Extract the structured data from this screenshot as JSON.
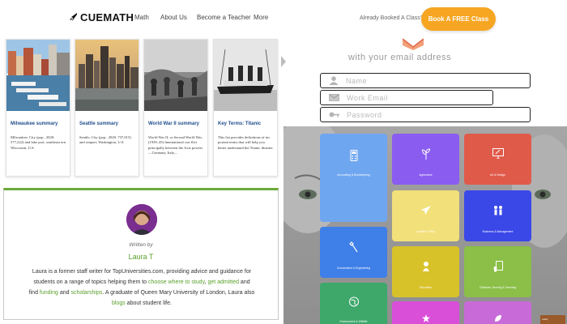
{
  "header": {
    "logo_text": "CUEMATH",
    "nav": [
      "Math",
      "About Us",
      "Become a Teacher",
      "More"
    ],
    "booked_text": "Already Booked A Class?",
    "cta_label": "Book A FREE Class",
    "cta_color": "#f6a623"
  },
  "cards": [
    {
      "title": "Milwaukee summary",
      "text": "Milwaukee, City (pop., 2020: 577,222) and lake port, southeast ern Wisconsin, U.S."
    },
    {
      "title": "Seattle summary",
      "text": "Seattle, City (pop., 2020: 737,015) and seaport, Washington, U.S."
    },
    {
      "title": "World War II summary",
      "text": "World War II, or Second World War, (1939–45) International con flict principally between the Axis powers—Germany, Italy,..."
    },
    {
      "title": "Key Terms: Titanic",
      "text": "This list provides definitions of im portant terms that will help you better understand the Titanic disaster."
    }
  ],
  "author": {
    "written_by": "Written by",
    "name": "Laura T",
    "bio_1": "Laura is a former staff writer for TopUniversities.com, providing advice and guidance for",
    "bio_2": "students on a range of topics helping them to ",
    "link_choose": "choose where to study",
    "sep_1": ", ",
    "link_admitted": "get admitted",
    "sep_2": " and",
    "bio_3": "find ",
    "link_funding": "funding",
    "sep_3": " and ",
    "link_scholarships": "scholarships",
    "bio_4": ". A graduate of Queen Mary University of London, Laura also",
    "link_blogs": "blogs",
    "bio_5": " about student life.",
    "accent": "#5aa02c"
  },
  "signup": {
    "heading": "with your email address",
    "name_placeholder": "Name",
    "email_placeholder": "Work Email",
    "password_placeholder": "Password"
  },
  "categories": [
    {
      "label": "Accounting & Bookkeeping",
      "color": "#6fa6f0",
      "icon": "calculator-icon"
    },
    {
      "label": "Agriculture",
      "color": "#8a5cf0",
      "icon": "plant-icon"
    },
    {
      "label": "Art & Design",
      "color": "#e05a4a",
      "icon": "monitor-icon"
    },
    {
      "label": "Aviation & Pilot",
      "color": "#f2e07a",
      "icon": "plane-icon"
    },
    {
      "label": "Business & Management",
      "color": "#3a48e8",
      "icon": "people-icon"
    },
    {
      "label": "Construction & Engineering",
      "color": "#3f7fe8",
      "icon": "tools-icon"
    },
    {
      "label": "Education",
      "color": "#d8c22a",
      "icon": "grad-icon"
    },
    {
      "label": "Childcare, Nursing & Teaching",
      "color": "#8bbf48",
      "icon": "book-icon"
    },
    {
      "label": "Environment & Wildlife",
      "color": "#3da86a",
      "icon": "globe-icon"
    },
    {
      "label": "",
      "color": "#d94fd8",
      "icon": "star-icon"
    },
    {
      "label": "",
      "color": "#c86ad8",
      "icon": "leaf-icon"
    }
  ]
}
